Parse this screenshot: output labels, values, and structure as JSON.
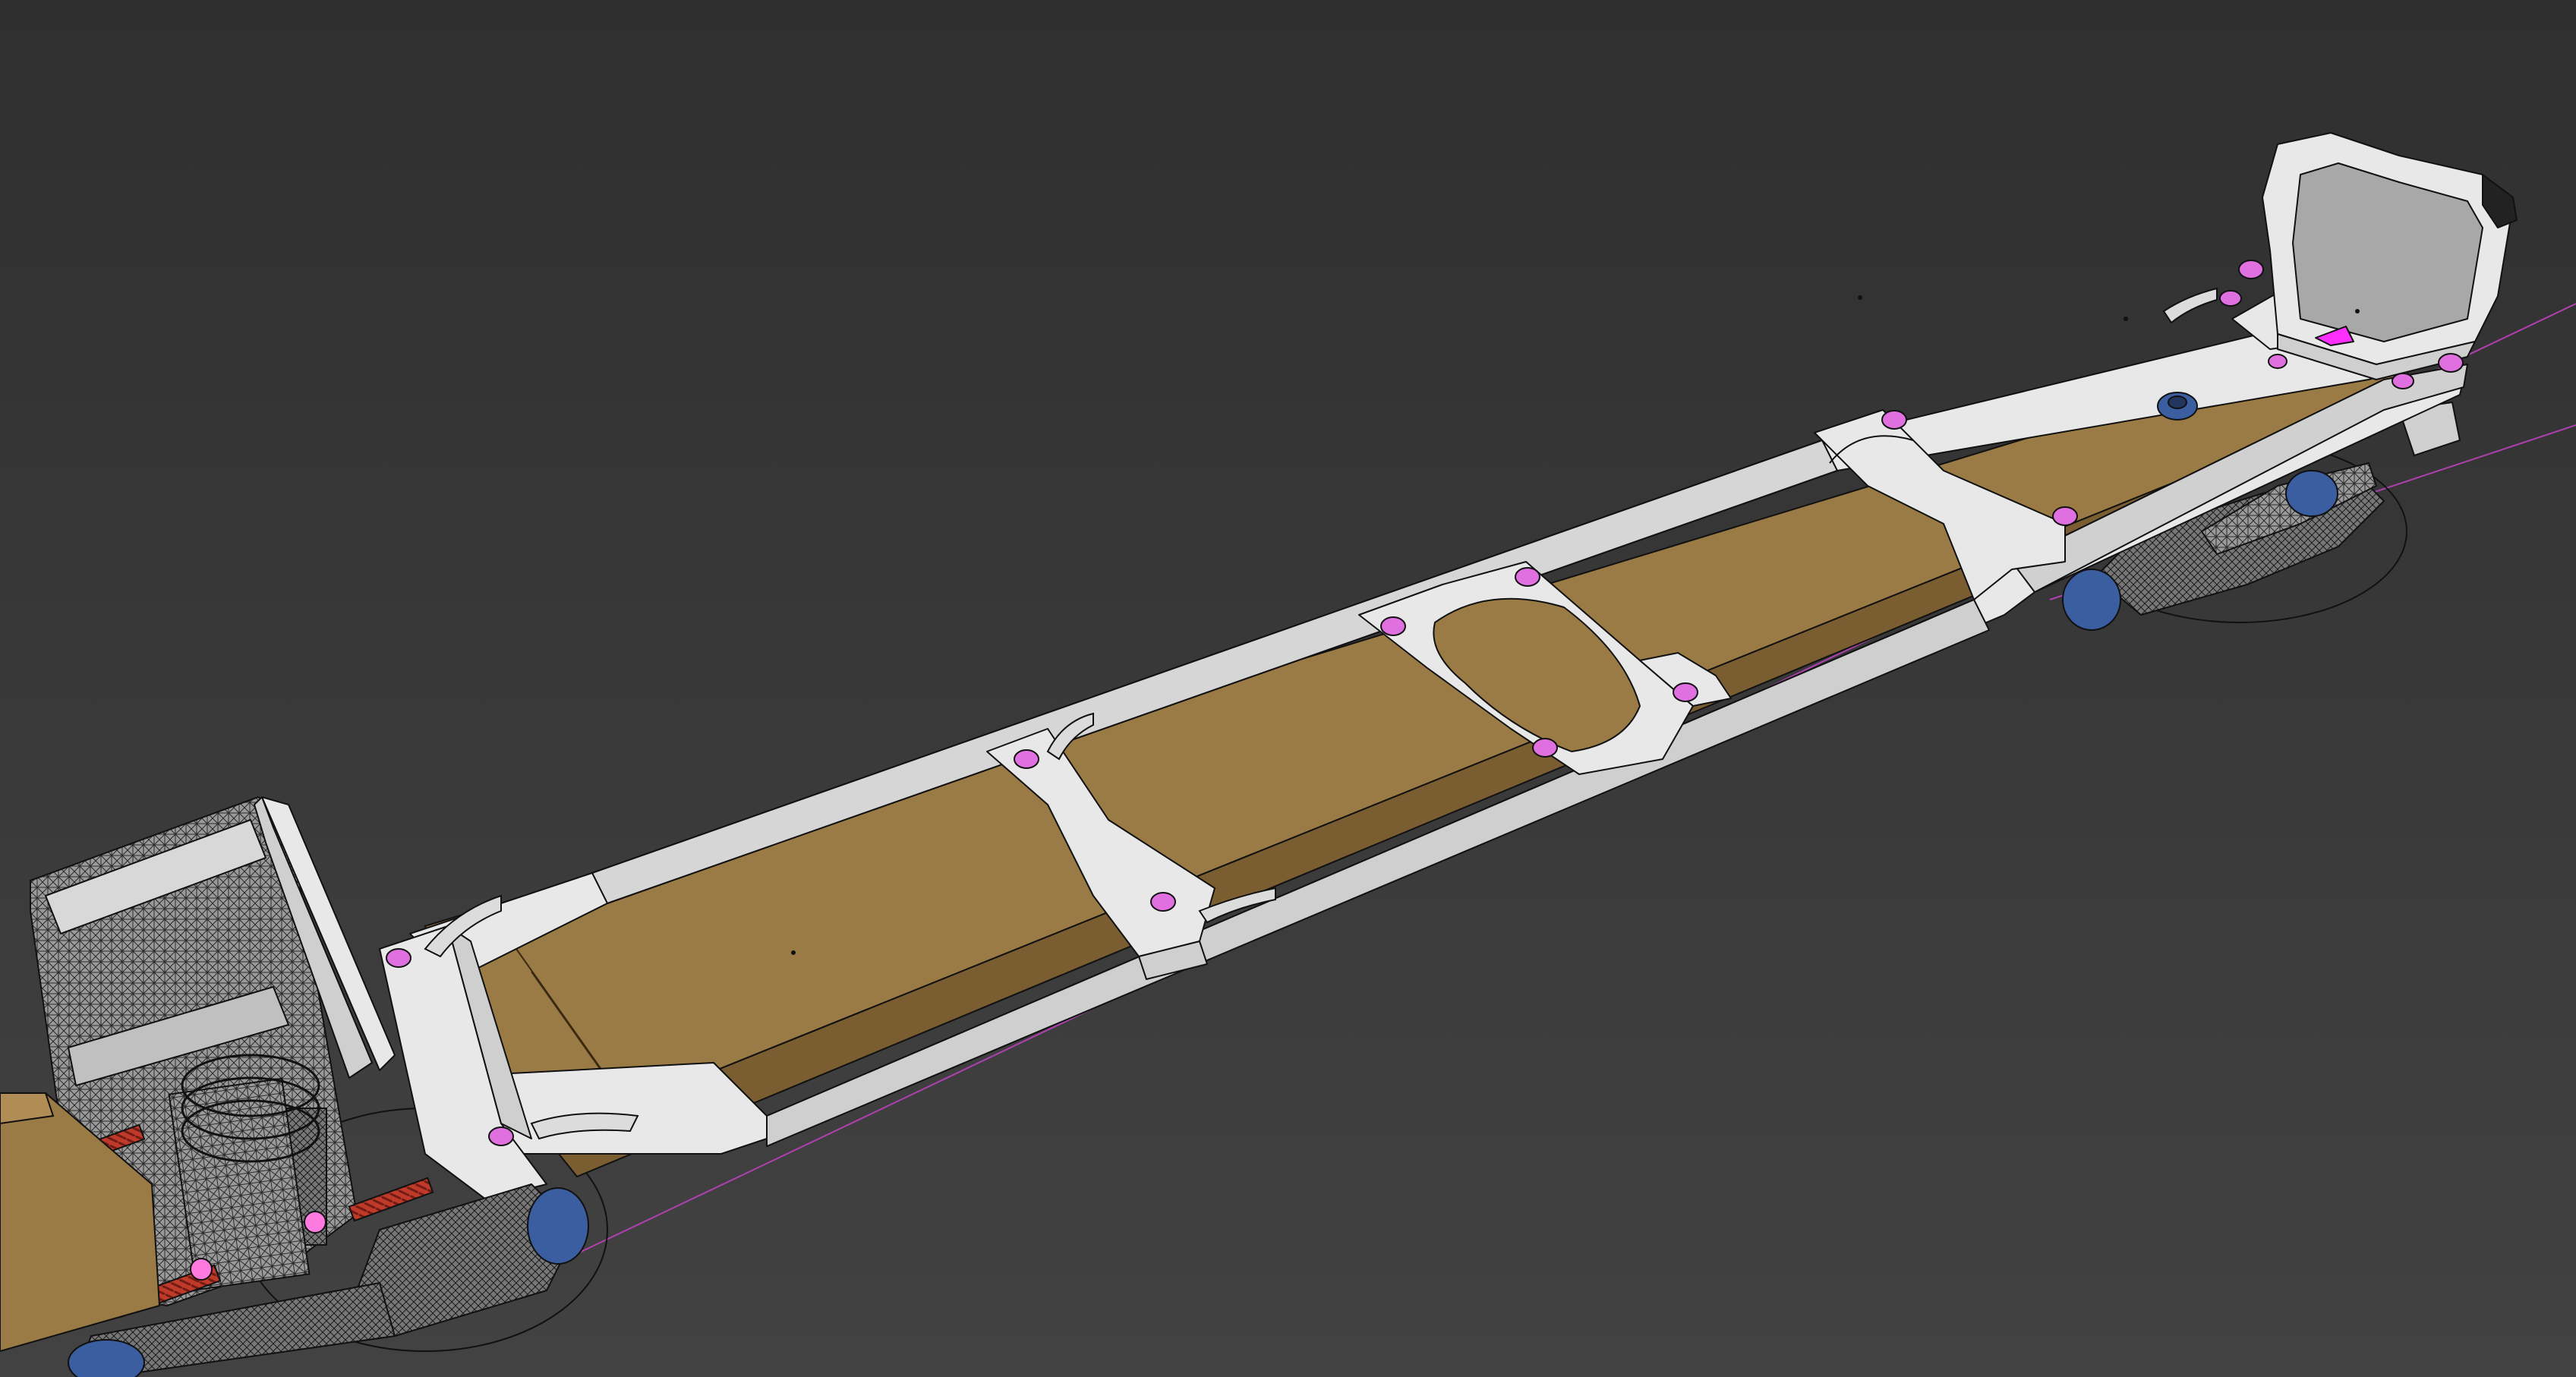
{
  "viewport": {
    "background": "#3a3a3a",
    "background_top": "#2f2f2f",
    "background_bottom": "#424242"
  },
  "model": {
    "frame_color": "#e8e8e8",
    "frame_edge_color": "#111111",
    "deck_color": "#9a7a45",
    "deck_dark_color": "#7a5e32",
    "bolt_color": "#e070e0",
    "guide_line_color": "#b040b0",
    "spring_color": "#c03a2a",
    "wheel_color": "#3a5ea0",
    "mechanism_color": "#8a8a8a",
    "highlight_color": "#ff30ff"
  },
  "icons": {
    "bolt": "bolt-icon",
    "wheel": "wheel-icon"
  }
}
